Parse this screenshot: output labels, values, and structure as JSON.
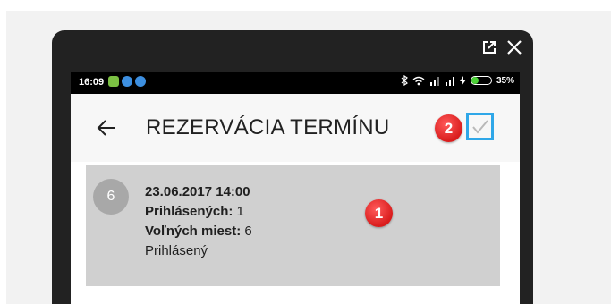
{
  "status_bar": {
    "time": "16:09",
    "battery_percent": "35%",
    "battery_level": 0.35,
    "icons": [
      "bluetooth-icon",
      "wifi-icon",
      "signal-icon",
      "signal-icon",
      "charging-icon",
      "battery-icon"
    ]
  },
  "window_tools": {
    "icons": [
      "external-link-icon",
      "close-icon"
    ]
  },
  "app_bar": {
    "title": "REZERVÁCIA TERMÍNU",
    "back_icon": "arrow-left-icon",
    "confirm_icon": "checkmark-icon"
  },
  "annotations": {
    "marker_1": "1",
    "marker_2": "2",
    "marker_color": "#e02323",
    "highlight_color": "#2fa7e8"
  },
  "reservation": {
    "avatar_number": "6",
    "datetime": "23.06.2017 14:00",
    "registered_label": "Prihlásených:",
    "registered_value": " 1",
    "free_label": "Voľných miest:",
    "free_value": " 6",
    "status": "Prihlásený"
  }
}
